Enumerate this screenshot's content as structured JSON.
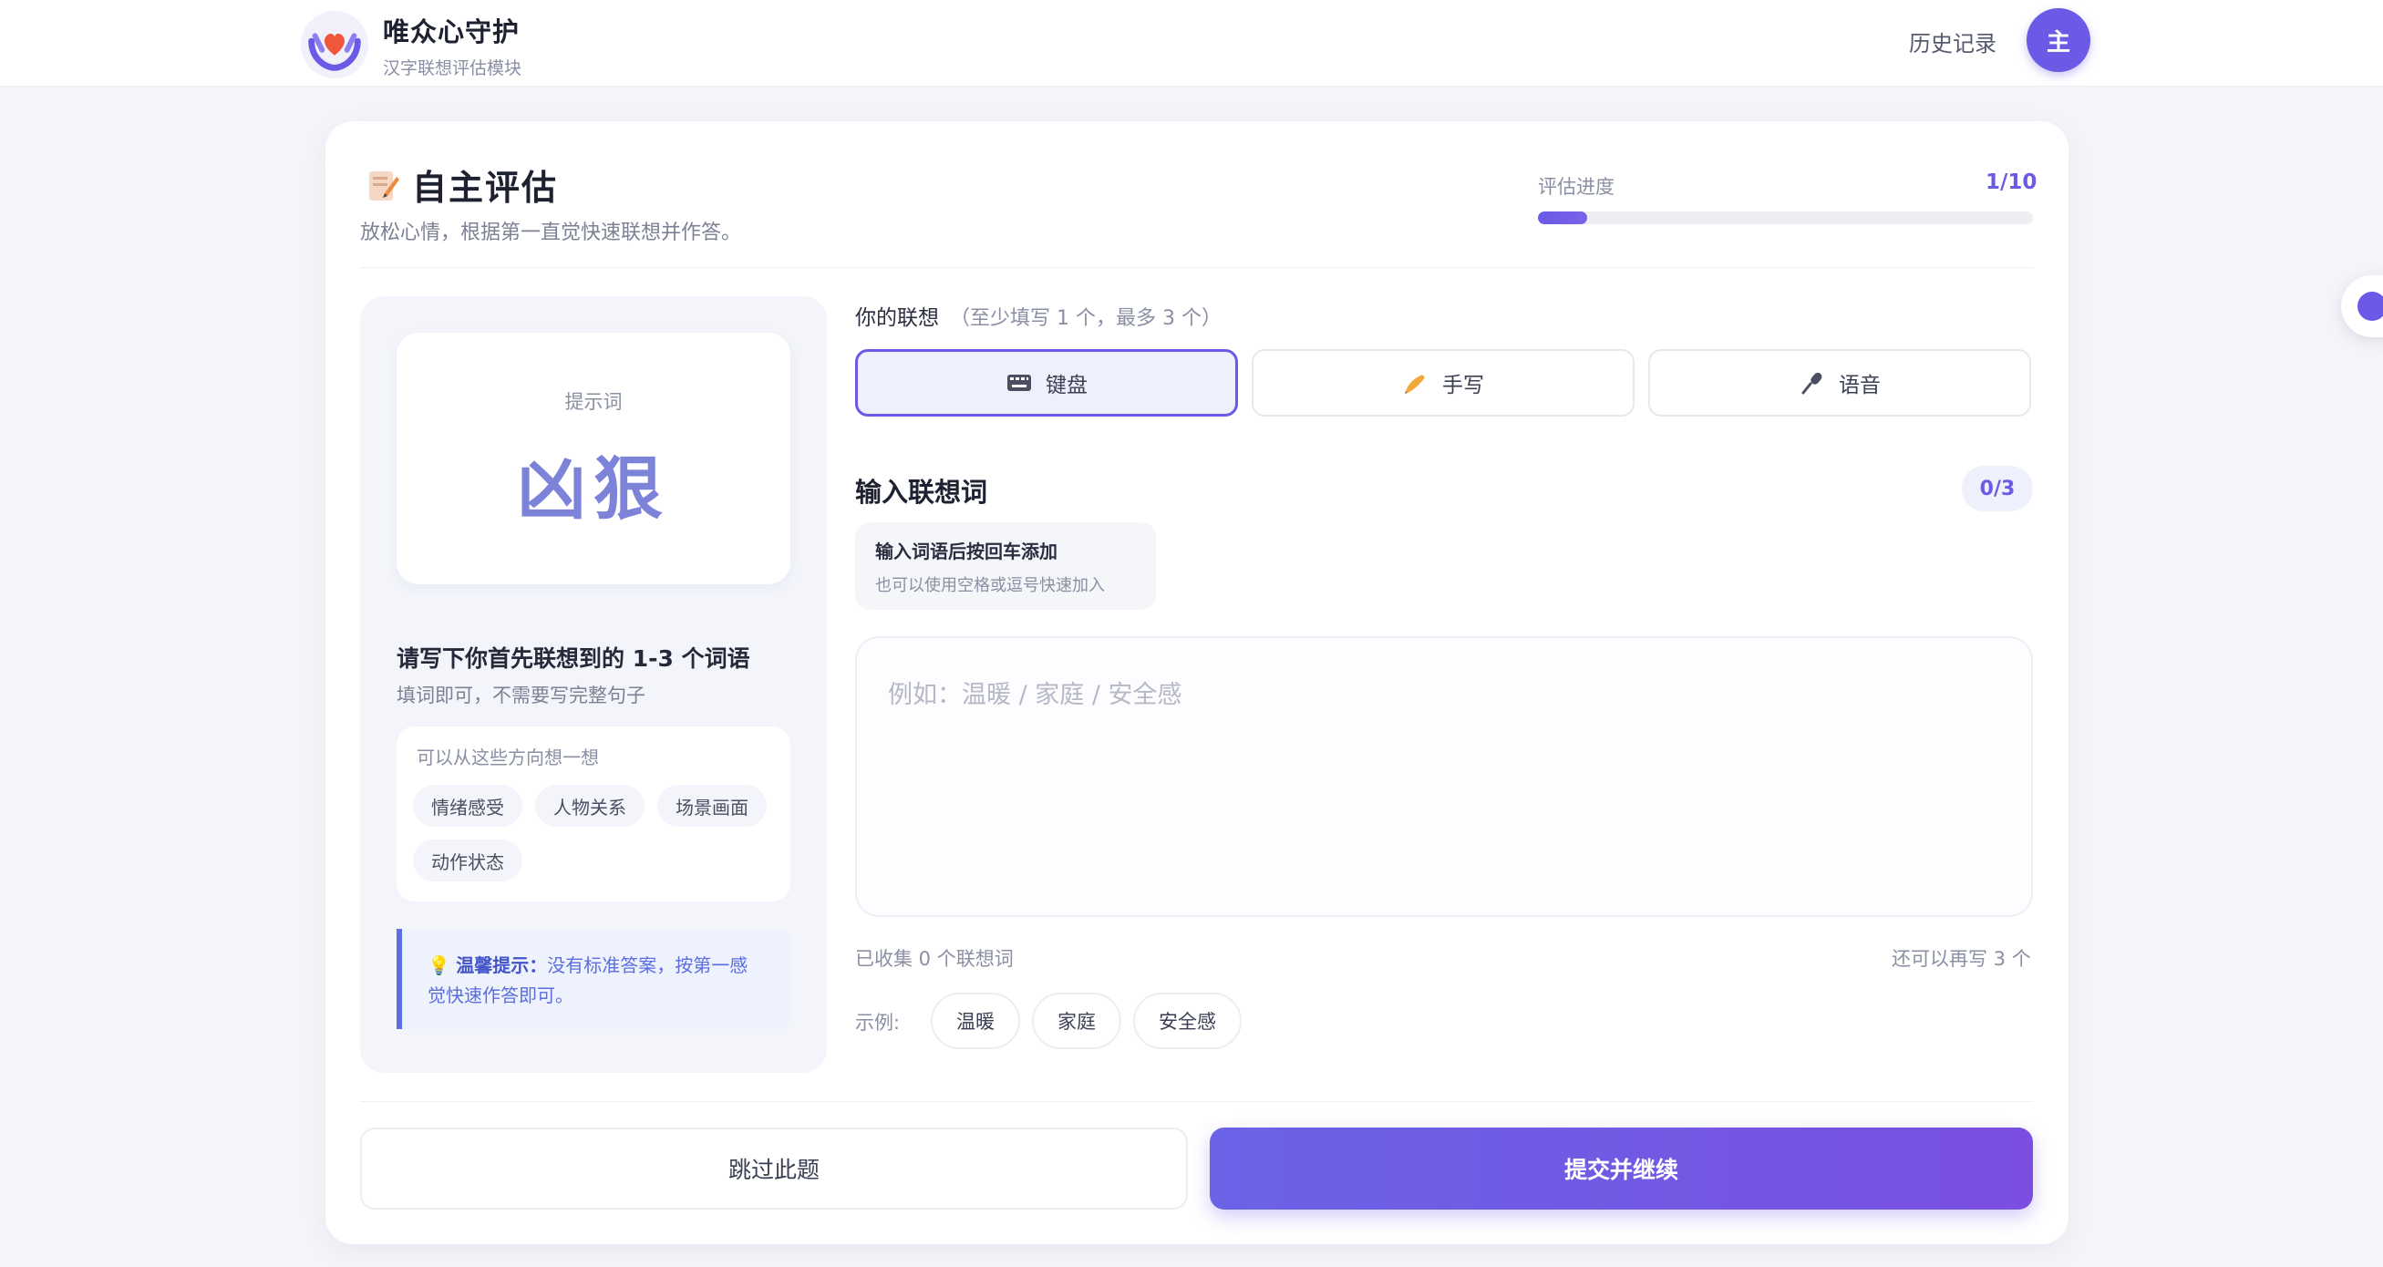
{
  "header": {
    "brand_name": "唯众心守护",
    "brand_sub": "汉字联想评估模块",
    "history_label": "历史记录",
    "avatar_text": "主"
  },
  "page": {
    "title": "自主评估",
    "subtitle": "放松心情，根据第一直觉快速联想并作答。",
    "progress_label": "评估进度",
    "progress_count": "1/10",
    "progress_fraction": 0.1
  },
  "left": {
    "cue_label": "提示词",
    "cue_word": "凶狠",
    "heading": "请写下你首先联想到的 1-3 个词语",
    "hint": "填词即可，不需要写完整句子",
    "directions_title": "可以从这些方向想一想",
    "directions": [
      "情绪感受",
      "人物关系",
      "场景画面",
      "动作状态"
    ],
    "tip_label": "温馨提示：",
    "tip_text": "没有标准答案，按第一感觉快速作答即可。"
  },
  "right": {
    "assoc_title": "你的联想",
    "assoc_note": "（至少填写 1 个，最多 3 个）",
    "modes": [
      {
        "label": "键盘",
        "icon": "keyboard-icon",
        "active": true
      },
      {
        "label": "手写",
        "icon": "handwriting-icon",
        "active": false
      },
      {
        "label": "语音",
        "icon": "microphone-icon",
        "active": false
      }
    ],
    "input_heading": "输入联想词",
    "count_badge": "0/3",
    "hint_main": "输入词语后按回车添加",
    "hint_sub": "也可以使用空格或逗号快速加入",
    "placeholder": "例如：温暖 / 家庭 / 安全感",
    "collected": "已收集 0 个联想词",
    "remaining": "还可以再写 3 个",
    "examples_label": "示例:",
    "examples": [
      "温暖",
      "家庭",
      "安全感"
    ]
  },
  "actions": {
    "skip": "跳过此题",
    "submit": "提交并继续"
  },
  "colors": {
    "accent": "#6a5ae6",
    "cue_word": "#7c83d9",
    "tip": "#5b6de0"
  }
}
